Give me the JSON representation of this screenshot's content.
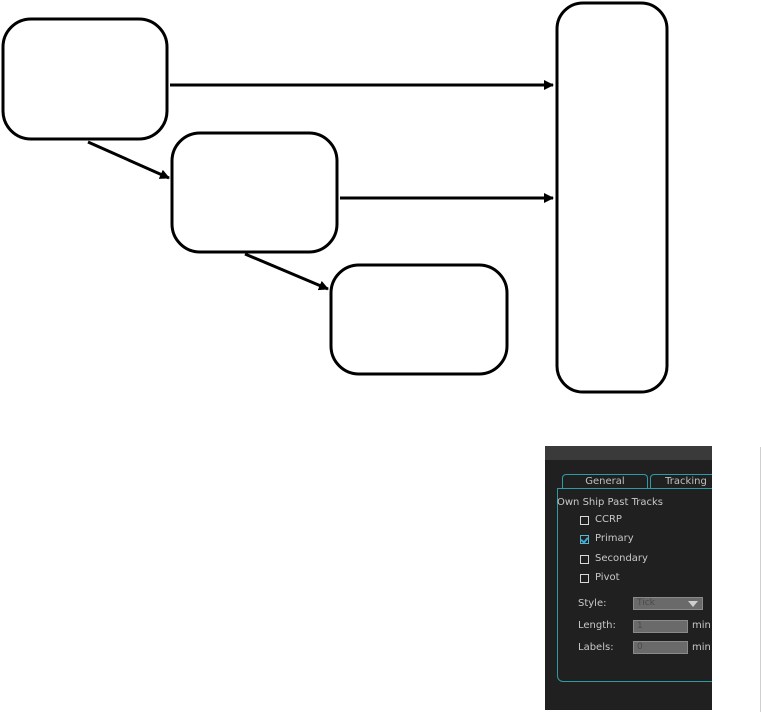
{
  "panel": {
    "tabs": [
      "General",
      "Tracking"
    ],
    "section_title": "Own Ship Past Tracks",
    "checkboxes": [
      {
        "label": "CCRP",
        "checked": false
      },
      {
        "label": "Primary",
        "checked": true
      },
      {
        "label": "Secondary",
        "checked": false
      },
      {
        "label": "Pivot",
        "checked": false
      }
    ],
    "fields": {
      "style": {
        "label": "Style:",
        "value": "Tick"
      },
      "length": {
        "label": "Length:",
        "value": "1",
        "unit": "min"
      },
      "labels": {
        "label": "Labels:",
        "value": "0",
        "unit": "min"
      }
    },
    "colors": {
      "background": "#202020",
      "accent": "#2d9aa8",
      "text": "#c8c8c8"
    }
  }
}
